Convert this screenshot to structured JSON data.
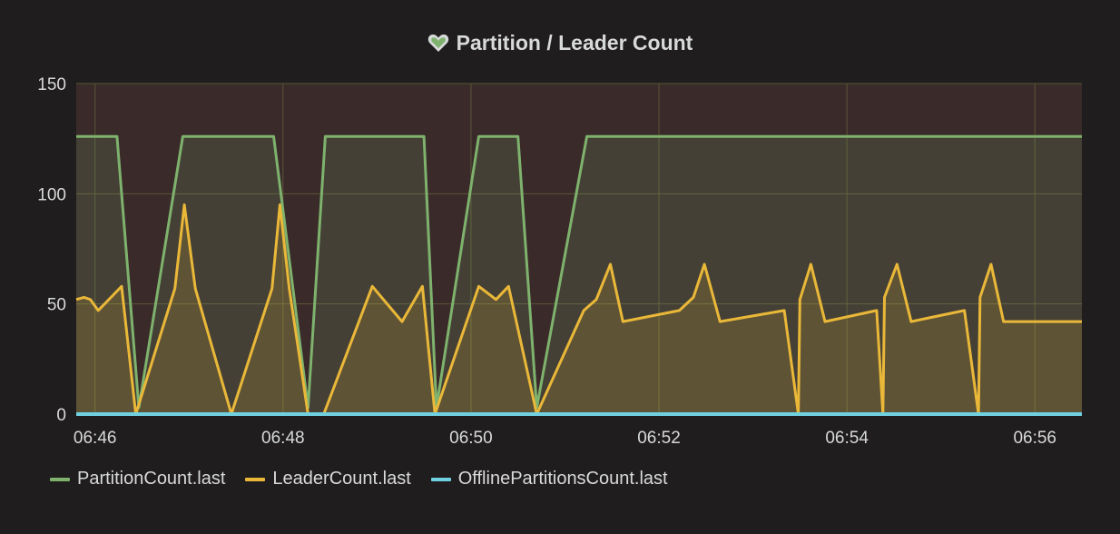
{
  "panel": {
    "title": "Partition / Leader Count",
    "icon": "heart-icon"
  },
  "chart_data": {
    "type": "line",
    "title": "Partition / Leader Count",
    "xlabel": "",
    "ylabel": "",
    "x_ticks": [
      "06:46",
      "06:48",
      "06:50",
      "06:52",
      "06:54",
      "06:56"
    ],
    "y_ticks": [
      0,
      50,
      100,
      150
    ],
    "xlim": [
      "06:45:48",
      "06:56:30"
    ],
    "ylim": [
      0,
      150
    ],
    "grid": true,
    "legend": "bottom-left",
    "colors": {
      "background": "#1f1d1d",
      "grid": "#5a5637",
      "alert_band": "#3a2a2a"
    },
    "series": [
      {
        "name": "PartitionCount.last",
        "color": "#7eb26d",
        "fill": true,
        "points": [
          [
            "06:45:48",
            126
          ],
          [
            "06:46:14",
            126
          ],
          [
            "06:46:28",
            3
          ],
          [
            "06:46:56",
            126
          ],
          [
            "06:47:54",
            126
          ],
          [
            "06:48:16",
            3
          ],
          [
            "06:48:27",
            126
          ],
          [
            "06:49:30",
            126
          ],
          [
            "06:49:38",
            3
          ],
          [
            "06:50:05",
            126
          ],
          [
            "06:50:30",
            126
          ],
          [
            "06:50:42",
            3
          ],
          [
            "06:51:14",
            126
          ],
          [
            "06:56:30",
            126
          ]
        ]
      },
      {
        "name": "LeaderCount.last",
        "color": "#eab839",
        "fill": true,
        "points": [
          [
            "06:45:48",
            52
          ],
          [
            "06:45:53",
            53
          ],
          [
            "06:45:57",
            52
          ],
          [
            "06:46:02",
            47
          ],
          [
            "06:46:17",
            58
          ],
          [
            "06:46:26",
            0
          ],
          [
            "06:46:51",
            57
          ],
          [
            "06:46:57",
            95
          ],
          [
            "06:47:04",
            57
          ],
          [
            "06:47:27",
            0
          ],
          [
            "06:47:53",
            57
          ],
          [
            "06:47:58",
            95
          ],
          [
            "06:48:04",
            57
          ],
          [
            "06:48:16",
            0
          ],
          [
            "06:48:26",
            0
          ],
          [
            "06:48:57",
            58
          ],
          [
            "06:49:16",
            42
          ],
          [
            "06:49:29",
            58
          ],
          [
            "06:49:37",
            0
          ],
          [
            "06:50:05",
            58
          ],
          [
            "06:50:16",
            52
          ],
          [
            "06:50:24",
            58
          ],
          [
            "06:50:42",
            0
          ],
          [
            "06:51:12",
            47
          ],
          [
            "06:51:20",
            52
          ],
          [
            "06:51:29",
            68
          ],
          [
            "06:51:37",
            42
          ],
          [
            "06:52:13",
            47
          ],
          [
            "06:52:22",
            53
          ],
          [
            "06:52:29",
            68
          ],
          [
            "06:52:39",
            42
          ],
          [
            "06:53:20",
            47
          ],
          [
            "06:53:29",
            0
          ],
          [
            "06:53:30",
            52
          ],
          [
            "06:53:37",
            68
          ],
          [
            "06:53:46",
            42
          ],
          [
            "06:54:19",
            47
          ],
          [
            "06:54:23",
            0
          ],
          [
            "06:54:24",
            53
          ],
          [
            "06:54:32",
            68
          ],
          [
            "06:54:41",
            42
          ],
          [
            "06:55:15",
            47
          ],
          [
            "06:55:24",
            0
          ],
          [
            "06:55:25",
            53
          ],
          [
            "06:55:32",
            68
          ],
          [
            "06:55:40",
            42
          ],
          [
            "06:56:30",
            42
          ]
        ]
      },
      {
        "name": "OfflinePartitionsCount.last",
        "color": "#6ed0e0",
        "fill": false,
        "points": [
          [
            "06:45:48",
            0
          ],
          [
            "06:56:30",
            0
          ]
        ]
      }
    ]
  }
}
